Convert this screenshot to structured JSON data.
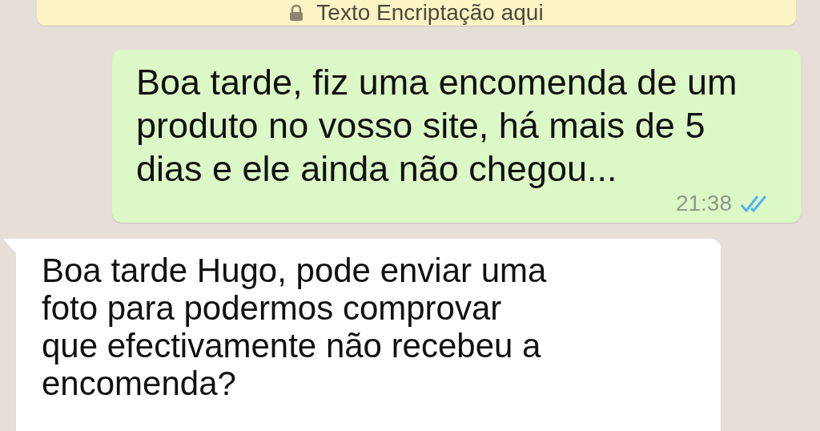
{
  "encryption_notice": {
    "text": "Texto Encriptação aqui"
  },
  "messages": [
    {
      "kind": "outgoing",
      "text": "Boa tarde, fiz uma encomenda de um produto no vosso site, há mais de 5 dias e ele ainda não chegou...",
      "time": "21:38",
      "read": true
    },
    {
      "kind": "incoming",
      "text": "Boa tarde Hugo, pode enviar uma foto para podermos comprovar que efectivamente não recebeu a encomenda?"
    }
  ]
}
